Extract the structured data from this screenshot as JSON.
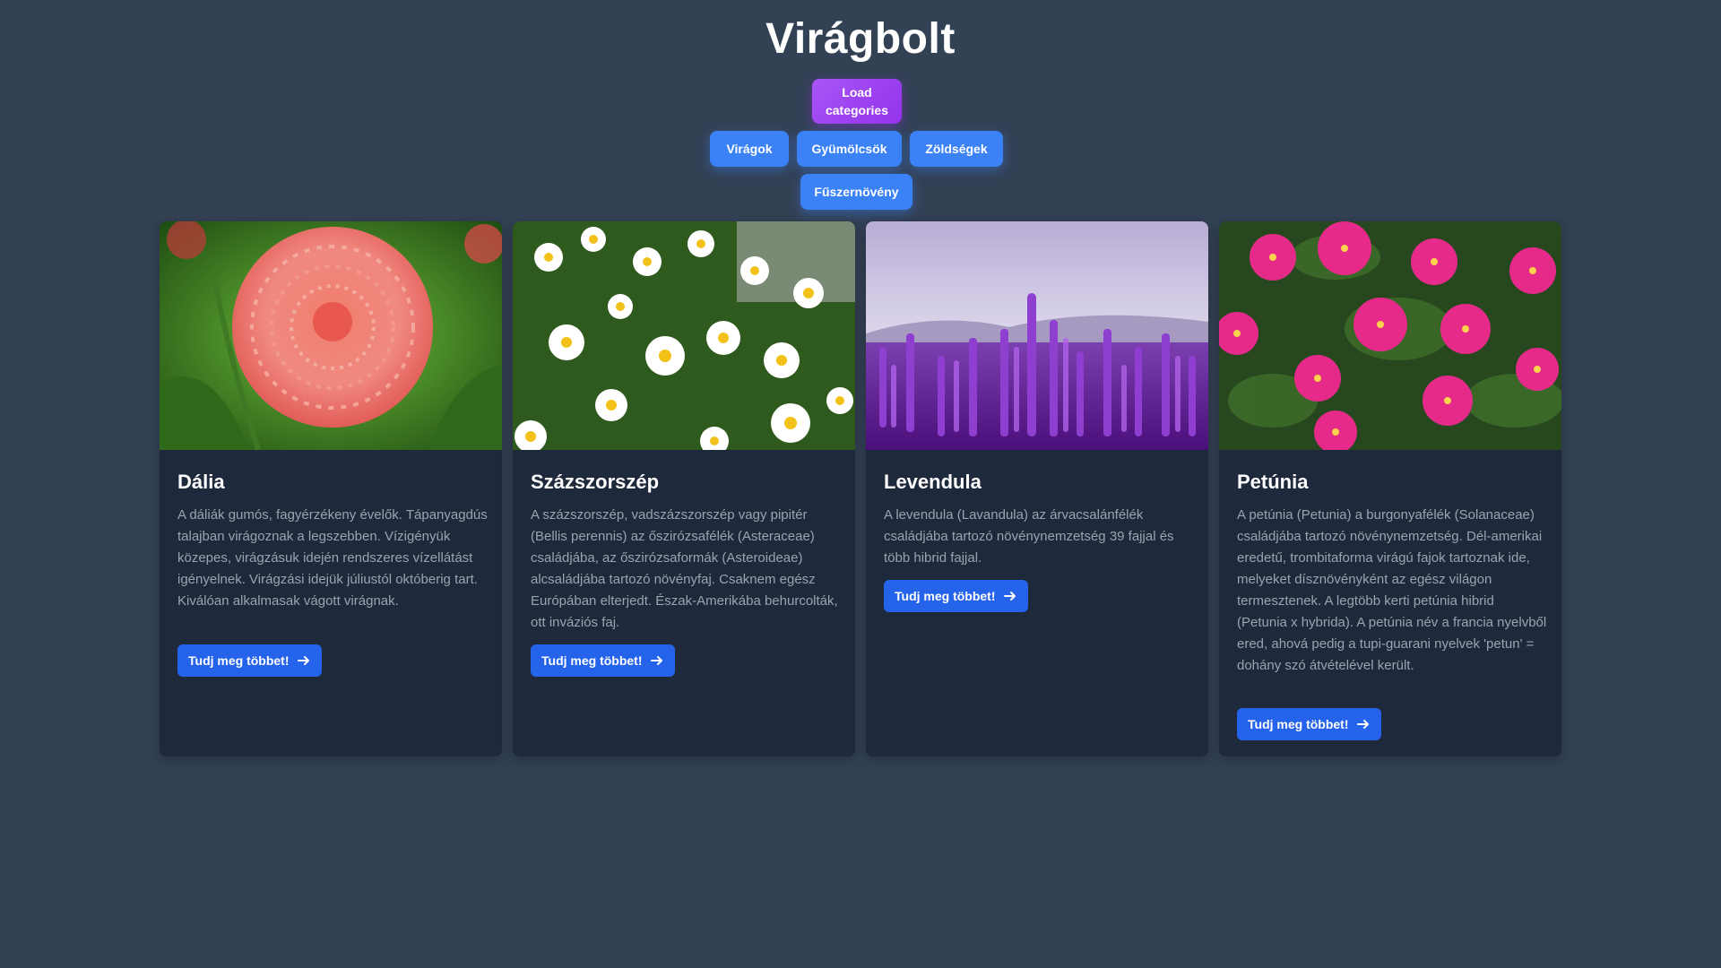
{
  "header": {
    "title": "Virágbolt",
    "load_label": "Load categories"
  },
  "categories": [
    {
      "label": "Virágok"
    },
    {
      "label": "Gyümölcsök"
    },
    {
      "label": "Zöldségek"
    },
    {
      "label": "Fűszernövény"
    }
  ],
  "cards": [
    {
      "title": "Dália",
      "description": "A dáliák gumós, fagyérzékeny évelők. Tápanyagdús talajban virágoznak a legszebben. Vízigényük közepes, virágzásuk idején rendszeres vízellátást igényelnek. Virágzási idejük júliustól októberig tart. Kiválóan alkalmasak vágott virágnak.",
      "button": "Tudj meg többet!",
      "image_icon": "dahlia-photo"
    },
    {
      "title": "Százszorszép",
      "description": "A százszorszép, vadszázszorszép vagy pipitér (Bellis perennis) az őszirózsafélék (Asteraceae) családjába, az őszirózsaformák (Asteroideae) alcsaládjába tartozó növényfaj. Csaknem egész Európában elterjedt. Észak-Amerikába behurcolták, ott inváziós faj.",
      "button": "Tudj meg többet!",
      "image_icon": "daisy-photo"
    },
    {
      "title": "Levendula",
      "description": "A levendula (Lavandula) az árvacsalánfélék családjába tartozó növénynemzetség 39 fajjal és több hibrid fajjal.",
      "button": "Tudj meg többet!",
      "image_icon": "lavender-photo"
    },
    {
      "title": "Petúnia",
      "description": "A petúnia (Petunia) a burgonyafélék (Solanaceae) családjába tartozó növénynemzetség. Dél-amerikai eredetű, trombitaforma virágú fajok tartoznak ide, melyeket dísznövényként az egész világon termesztenek. A legtöbb kerti petúnia hibrid (Petunia x hybrida). A petúnia név a francia nyelvből ered, ahová pedig a tupi-guarani nyelvek 'petun' = dohány szó átvételével került.",
      "button": "Tudj meg többet!",
      "image_icon": "petunia-photo"
    }
  ],
  "colors": {
    "background": "#334155",
    "card": "#1e293b",
    "accent_blue": "#3b82f6",
    "button_blue": "#2563eb",
    "accent_purple": "#9333ea"
  }
}
